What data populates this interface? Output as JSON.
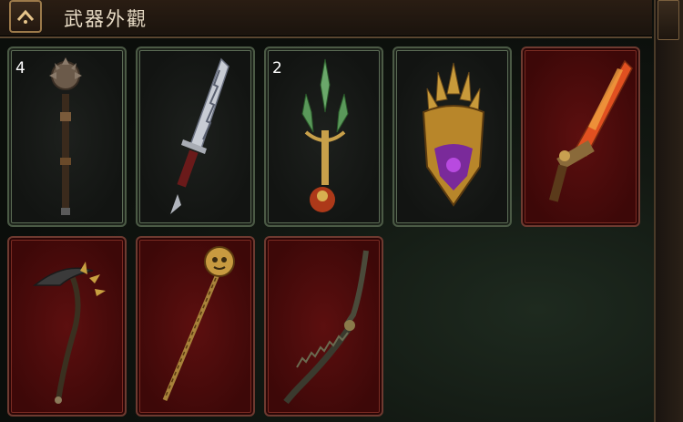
{
  "header": {
    "title": "武器外觀"
  },
  "slots": [
    {
      "name": "spiked-mace",
      "count": "4",
      "state": "owned"
    },
    {
      "name": "serrated-sword",
      "count": "",
      "state": "owned"
    },
    {
      "name": "jade-trident",
      "count": "2",
      "state": "owned"
    },
    {
      "name": "golden-crown-shield",
      "count": "",
      "state": "owned"
    },
    {
      "name": "flame-gun-blade",
      "count": "",
      "state": "locked"
    },
    {
      "name": "bone-scythe",
      "count": "",
      "state": "locked"
    },
    {
      "name": "skull-staff",
      "count": "",
      "state": "locked"
    },
    {
      "name": "dragon-blade",
      "count": "",
      "state": "locked"
    }
  ],
  "colors": {
    "owned_frame": "#4b5a45",
    "locked_bg": "#4a0a0a",
    "title_text": "#e8dcc6"
  }
}
